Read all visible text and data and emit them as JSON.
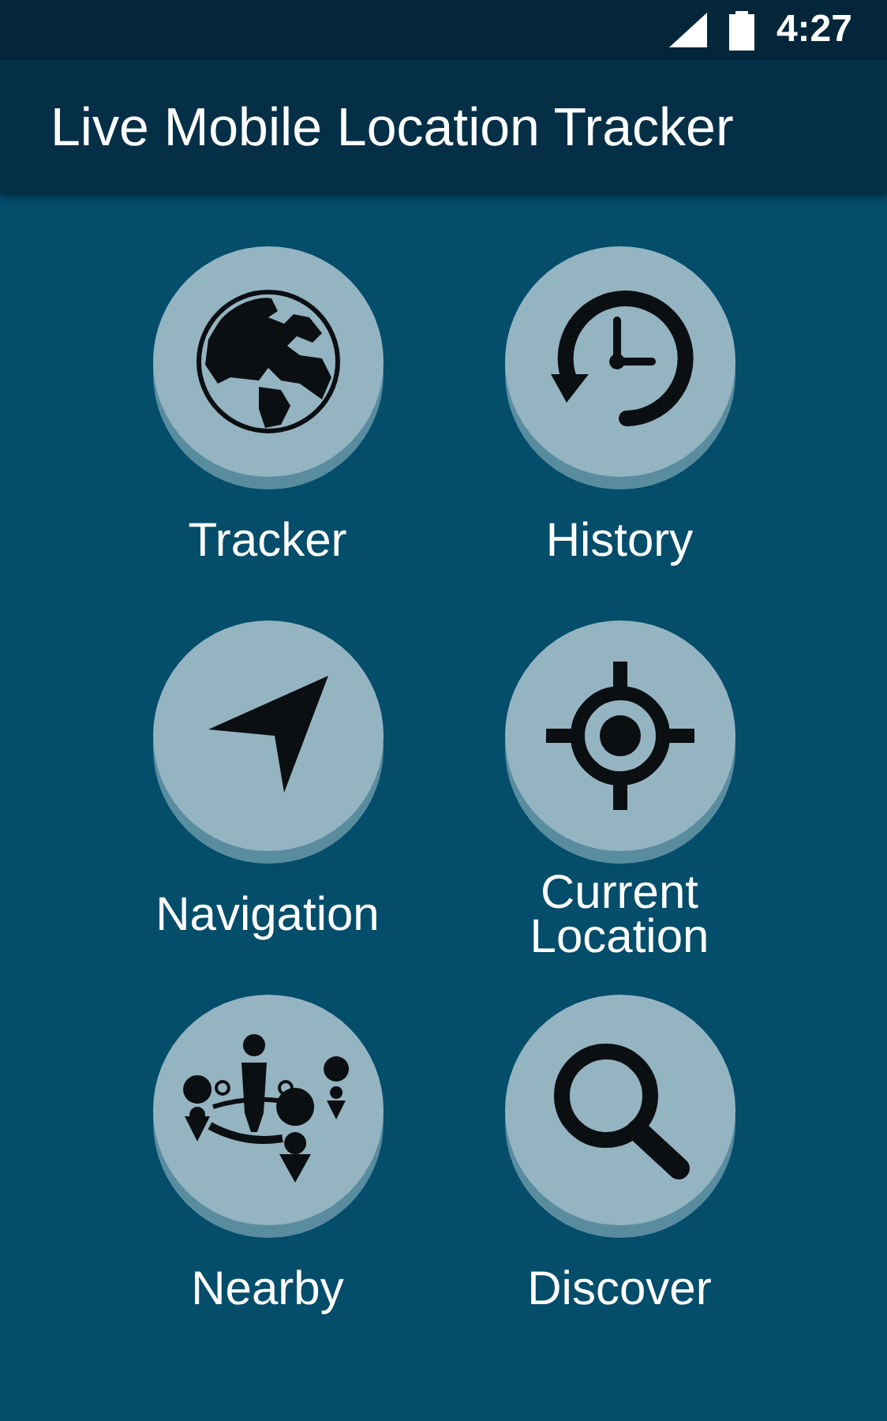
{
  "status_bar": {
    "time": "4:27"
  },
  "app_bar": {
    "title": "Live Mobile Location Tracker"
  },
  "menu": [
    {
      "label": "Tracker",
      "kind": "globe"
    },
    {
      "label": "History",
      "kind": "history"
    },
    {
      "label": "Navigation",
      "kind": "navigation"
    },
    {
      "label": "Current Location",
      "kind": "crosshair"
    },
    {
      "label": "Nearby",
      "kind": "nearby"
    },
    {
      "label": "Discover",
      "kind": "search"
    }
  ]
}
